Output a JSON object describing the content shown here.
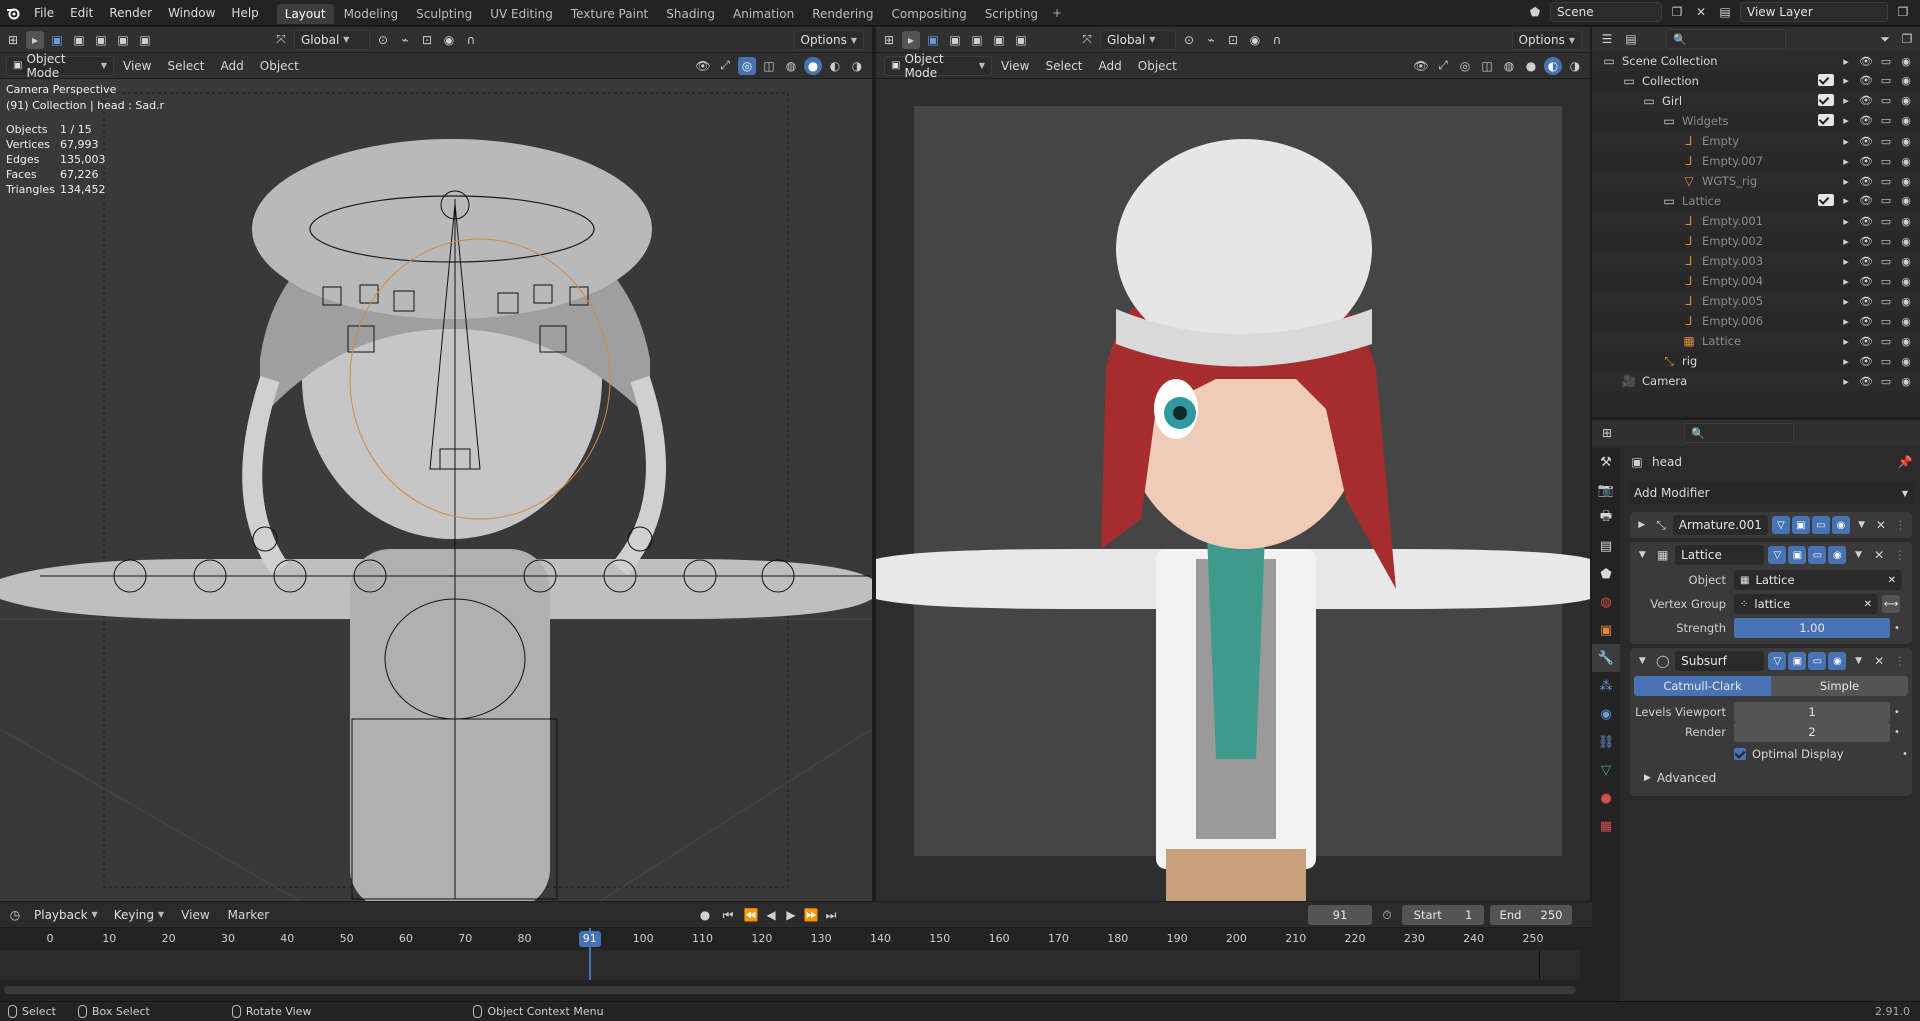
{
  "top_menu": [
    "File",
    "Edit",
    "Render",
    "Window",
    "Help"
  ],
  "workspaces": [
    "Layout",
    "Modeling",
    "Sculpting",
    "UV Editing",
    "Texture Paint",
    "Shading",
    "Animation",
    "Rendering",
    "Compositing",
    "Scripting"
  ],
  "active_workspace": "Layout",
  "scene": {
    "label": "Scene"
  },
  "view_layer": {
    "label": "View Layer"
  },
  "left_viewport": {
    "mode": "Object Mode",
    "menus": [
      "View",
      "Select",
      "Add",
      "Object"
    ],
    "transform": "Global",
    "options": "Options",
    "overlay_title": "Camera Perspective",
    "overlay_subtitle": "(91) Collection | head : Sad.r",
    "stats": [
      {
        "label": "Objects",
        "value": "1 / 15"
      },
      {
        "label": "Vertices",
        "value": "67,993"
      },
      {
        "label": "Edges",
        "value": "135,003"
      },
      {
        "label": "Faces",
        "value": "67,226"
      },
      {
        "label": "Triangles",
        "value": "134,452"
      }
    ]
  },
  "right_viewport": {
    "mode": "Object Mode",
    "menus": [
      "View",
      "Select",
      "Add",
      "Object"
    ],
    "transform": "Global",
    "options": "Options"
  },
  "outliner": {
    "rows": [
      {
        "name": "Scene Collection",
        "indent": 0,
        "dim": false,
        "icon": "scene-collection-icon"
      },
      {
        "name": "Collection",
        "indent": 1,
        "dim": false,
        "icon": "collection-icon",
        "check": true
      },
      {
        "name": "Girl",
        "indent": 2,
        "dim": false,
        "icon": "collection-icon",
        "check": true
      },
      {
        "name": "Widgets",
        "indent": 3,
        "dim": true,
        "icon": "collection-icon",
        "check": true
      },
      {
        "name": "Empty",
        "indent": 4,
        "dim": true,
        "icon": "empty-icon"
      },
      {
        "name": "Empty.007",
        "indent": 4,
        "dim": true,
        "icon": "empty-icon"
      },
      {
        "name": "WGTS_rig",
        "indent": 4,
        "dim": true,
        "icon": "mesh-icon"
      },
      {
        "name": "Lattice",
        "indent": 3,
        "dim": true,
        "icon": "collection-icon",
        "check": true
      },
      {
        "name": "Empty.001",
        "indent": 4,
        "dim": true,
        "icon": "empty-icon"
      },
      {
        "name": "Empty.002",
        "indent": 4,
        "dim": true,
        "icon": "empty-icon"
      },
      {
        "name": "Empty.003",
        "indent": 4,
        "dim": true,
        "icon": "empty-icon"
      },
      {
        "name": "Empty.004",
        "indent": 4,
        "dim": true,
        "icon": "empty-icon"
      },
      {
        "name": "Empty.005",
        "indent": 4,
        "dim": true,
        "icon": "empty-icon"
      },
      {
        "name": "Empty.006",
        "indent": 4,
        "dim": true,
        "icon": "empty-icon"
      },
      {
        "name": "Lattice",
        "indent": 4,
        "dim": true,
        "icon": "lattice-icon"
      },
      {
        "name": "rig",
        "indent": 3,
        "dim": false,
        "icon": "armature-icon"
      },
      {
        "name": "Camera",
        "indent": 1,
        "dim": false,
        "icon": "camera-icon"
      }
    ]
  },
  "properties": {
    "object_name": "head",
    "add_modifier": "Add Modifier",
    "modifiers": {
      "armature": {
        "name": "Armature.001"
      },
      "lattice": {
        "name": "Lattice",
        "object_label": "Object",
        "object_value": "Lattice",
        "vgroup_label": "Vertex Group",
        "vgroup_value": "lattice",
        "strength_label": "Strength",
        "strength_value": "1.00",
        "strength": 1.0
      },
      "subsurf": {
        "name": "Subsurf",
        "type_catmull": "Catmull-Clark",
        "type_simple": "Simple",
        "levels_label": "Levels Viewport",
        "levels_value": "1",
        "render_label": "Render",
        "render_value": "2",
        "optimal_label": "Optimal Display",
        "advanced_label": "Advanced"
      }
    }
  },
  "timeline": {
    "menus": [
      "Playback",
      "Keying",
      "View",
      "Marker"
    ],
    "current_frame": "91",
    "start_label": "Start",
    "start_value": "1",
    "end_label": "End",
    "end_value": "250",
    "ticks": [
      0,
      10,
      20,
      30,
      40,
      50,
      60,
      70,
      80,
      90,
      100,
      110,
      120,
      130,
      140,
      150,
      160,
      170,
      180,
      190,
      200,
      210,
      220,
      230,
      240,
      250
    ]
  },
  "statusbar": {
    "select": "Select",
    "box_select": "Box Select",
    "rotate_view": "Rotate View",
    "context_menu": "Object Context Menu",
    "version": "2.91.0"
  }
}
